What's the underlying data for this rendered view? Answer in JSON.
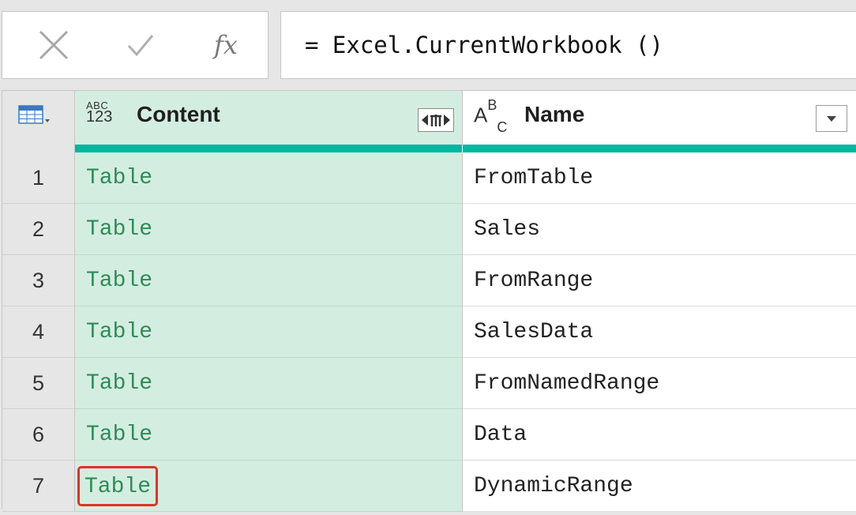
{
  "formula_bar": {
    "cancel_icon": "close-icon",
    "commit_icon": "check-icon",
    "fx_label": "fx",
    "formula": "= Excel.CurrentWorkbook ()"
  },
  "grid": {
    "columns": [
      {
        "name": "Content",
        "type_icon": "abc123-type-icon"
      },
      {
        "name": "Name",
        "type_icon": "abc-text-type-icon"
      }
    ],
    "quality_bar_color": "#00b7a2",
    "content_column_bg": "#d4ede1",
    "highlight_color": "#e0322a",
    "rows": [
      {
        "num": "1",
        "content": "Table",
        "name": "FromTable"
      },
      {
        "num": "2",
        "content": "Table",
        "name": "Sales"
      },
      {
        "num": "3",
        "content": "Table",
        "name": "FromRange"
      },
      {
        "num": "4",
        "content": "Table",
        "name": "SalesData"
      },
      {
        "num": "5",
        "content": "Table",
        "name": "FromNamedRange"
      },
      {
        "num": "6",
        "content": "Table",
        "name": "Data"
      },
      {
        "num": "7",
        "content": "Table",
        "name": "DynamicRange"
      }
    ]
  }
}
